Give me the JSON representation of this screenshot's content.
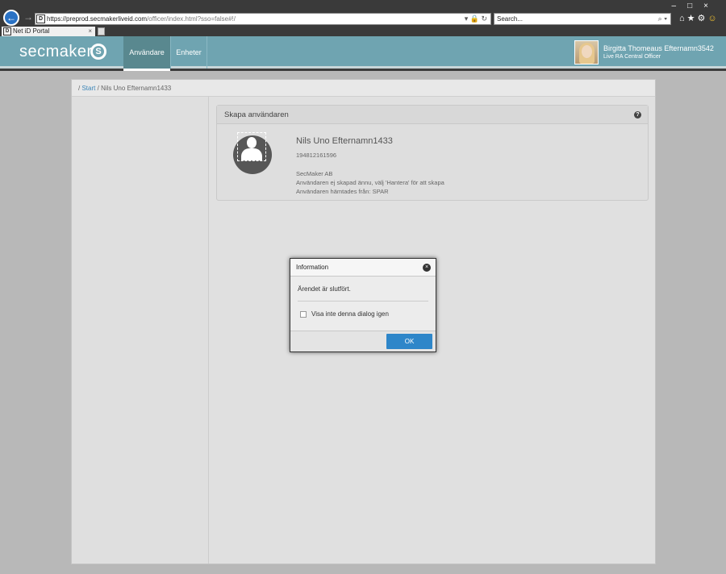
{
  "browser": {
    "url_host": "https://preprod.secmakerliveid.com",
    "url_path": "/officer/index.html?sso=false#!/",
    "search_placeholder": "Search...",
    "tab_title": "Net iD Portal",
    "site_icon": "D"
  },
  "app": {
    "brand": "secmaker",
    "nav": [
      {
        "label": "Användare",
        "active": true
      },
      {
        "label": "Enheter",
        "active": false
      }
    ],
    "user": {
      "name": "Birgitta Thomeaus Efternamn3542",
      "role": "Live RA Central Officer"
    }
  },
  "breadcrumb": {
    "sep": "/",
    "start": "Start",
    "current": "Nils Uno Efternamn1433"
  },
  "card": {
    "title": "Skapa användaren",
    "name": "Nils Uno Efternamn1433",
    "id": "194812161596",
    "org": "SecMaker AB",
    "status": "Användaren ej skapad ännu, välj 'Hantera' för att skapa",
    "source": "Användaren hämtades från: SPAR"
  },
  "dialog": {
    "title": "Information",
    "message": "Ärendet är slutfört.",
    "checkbox_label": "Visa inte denna dialog igen",
    "checkbox_checked": false,
    "ok_label": "OK"
  },
  "colors": {
    "nav_bg": "#6fa4b1",
    "nav_active": "#59888f",
    "ok_button": "#2e86c9"
  }
}
